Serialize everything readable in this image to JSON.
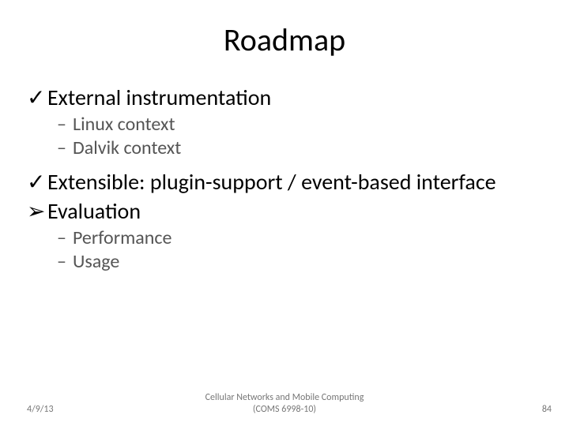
{
  "title": "Roadmap",
  "items": [
    {
      "bullet": "✓",
      "text": "External instrumentation"
    },
    {
      "bullet": "–",
      "text": "Linux context"
    },
    {
      "bullet": "–",
      "text": "Dalvik context"
    },
    {
      "bullet": "✓",
      "text": "Extensible: plugin-support / event-based interface"
    },
    {
      "bullet": "➢",
      "text": "Evaluation"
    },
    {
      "bullet": "–",
      "text": "Performance"
    },
    {
      "bullet": "–",
      "text": "Usage"
    }
  ],
  "footer": {
    "date": "4/9/13",
    "center_line1": "Cellular Networks and Mobile Computing",
    "center_line2": "(COMS 6998-10)",
    "page": "84"
  }
}
